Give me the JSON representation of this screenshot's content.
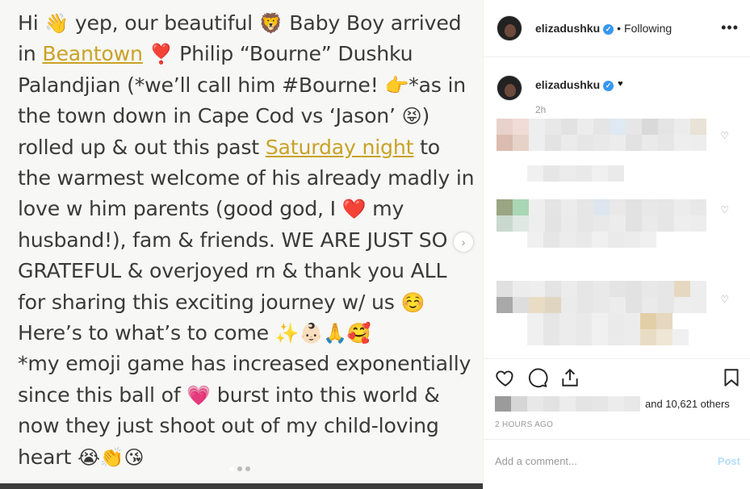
{
  "post_image": {
    "lines": [
      {
        "parts": [
          {
            "t": "Hi "
          },
          {
            "e": "👋"
          },
          {
            "t": " yep, our beautiful "
          },
          {
            "e": "🦁"
          },
          {
            "t": " Baby Boy arrived"
          }
        ]
      },
      {
        "parts": [
          {
            "t": "in "
          },
          {
            "l": "Beantown"
          },
          {
            "t": " "
          },
          {
            "e": "❣️"
          },
          {
            "t": " Philip “Bourne” Dushku"
          }
        ]
      },
      {
        "parts": [
          {
            "t": "Palandjian (*we’ll call him #Bourne! "
          },
          {
            "e": "👉"
          },
          {
            "t": "*as in"
          }
        ]
      },
      {
        "parts": [
          {
            "t": "the town down in Cape Cod vs ‘Jason’ "
          },
          {
            "e": "😝"
          },
          {
            "t": ")"
          }
        ]
      },
      {
        "parts": [
          {
            "t": "rolled up & out this past "
          },
          {
            "l": "Saturday night"
          },
          {
            "t": " to"
          }
        ]
      },
      {
        "parts": [
          {
            "t": "the warmest welcome of his already madly in"
          }
        ]
      },
      {
        "parts": [
          {
            "t": "love w him parents (good god, I "
          },
          {
            "e": "❤️"
          },
          {
            "t": " my"
          }
        ]
      },
      {
        "parts": [
          {
            "t": "husband!), fam & friends. WE ARE JUST SO"
          }
        ]
      },
      {
        "parts": [
          {
            "t": "GRATEFUL & overjoyed rn & thank you ALL"
          }
        ]
      },
      {
        "parts": [
          {
            "t": "for sharing this exciting journey w/ us "
          },
          {
            "e": "☺️"
          }
        ]
      },
      {
        "parts": [
          {
            "t": "Here’s to what’s to come "
          },
          {
            "e": "✨👶🏻🙏🥰"
          }
        ]
      },
      {
        "parts": [
          {
            "t": "*my emoji game has increased exponentially"
          }
        ]
      },
      {
        "parts": [
          {
            "t": "since this ball of "
          },
          {
            "e": "💗"
          },
          {
            "t": " burst into this world &"
          }
        ]
      },
      {
        "parts": [
          {
            "t": "now they just shoot out of my child-loving"
          }
        ]
      },
      {
        "parts": [
          {
            "t": "heart "
          },
          {
            "e": "😭👏😘"
          }
        ]
      }
    ],
    "carousel_next": "›"
  },
  "header": {
    "username": "elizadushku",
    "separator": "•",
    "following": "Following",
    "more": "•••"
  },
  "caption": {
    "username": "elizadushku",
    "emoji": "♥",
    "time": "2h"
  },
  "actions": {
    "like_icon": "heart-outline",
    "comment_icon": "speech-bubble",
    "share_icon": "share-arrow",
    "save_icon": "bookmark"
  },
  "likes": {
    "text": "and 10,621 others"
  },
  "timestamp": "2 HOURS AGO",
  "comment_box": {
    "placeholder": "Add a comment...",
    "post_label": "Post"
  },
  "colors": {
    "link_gold": "#c9a227",
    "verified_blue": "#3897f0",
    "post_disabled": "#b2dffc"
  }
}
